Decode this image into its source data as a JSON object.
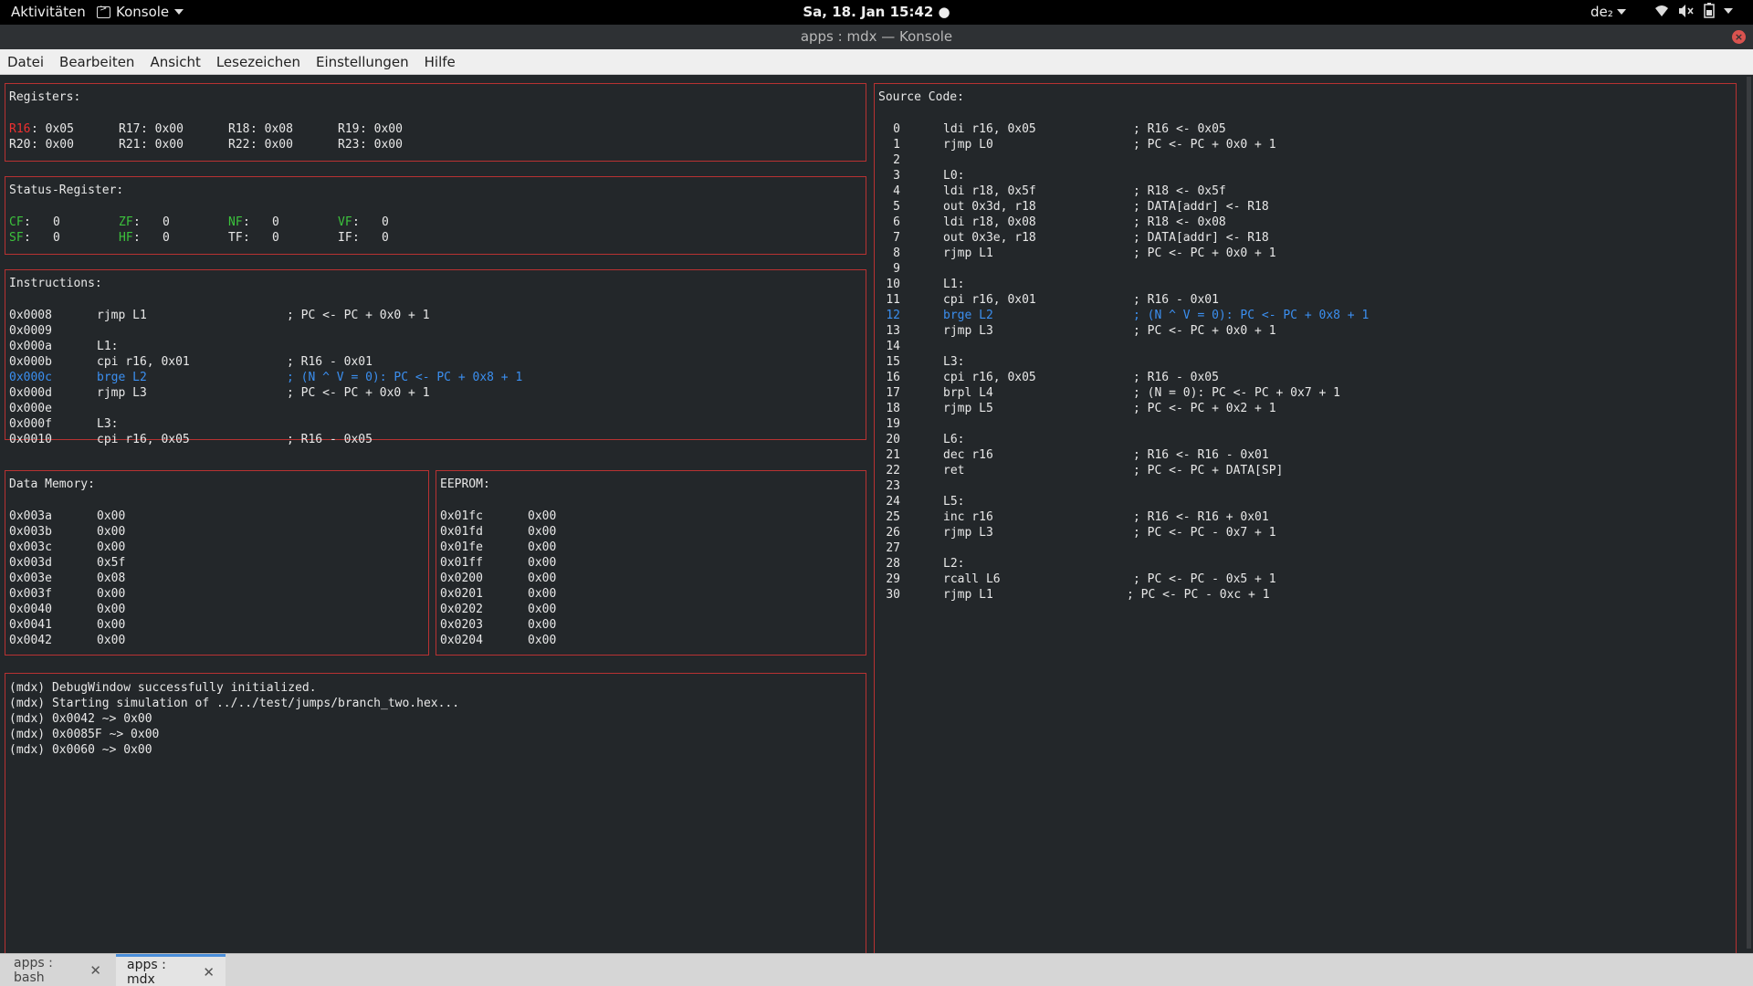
{
  "topbar": {
    "activities": "Aktivitäten",
    "app_menu": "Konsole",
    "clock": "Sa, 18. Jan  15:42 ●",
    "keyboard_layout": "de₂"
  },
  "window": {
    "title": "apps : mdx — Konsole"
  },
  "menubar": [
    "Datei",
    "Bearbeiten",
    "Ansicht",
    "Lesezeichen",
    "Einstellungen",
    "Hilfe"
  ],
  "registers": {
    "header": "Registers:",
    "rows": [
      [
        {
          "name": "R16",
          "value": ": 0x05",
          "highlight": true
        },
        {
          "name": "R17",
          "value": ": 0x00"
        },
        {
          "name": "R18",
          "value": ": 0x08"
        },
        {
          "name": "R19",
          "value": ": 0x00"
        }
      ],
      [
        {
          "name": "R20",
          "value": ": 0x00"
        },
        {
          "name": "R21",
          "value": ": 0x00"
        },
        {
          "name": "R22",
          "value": ": 0x00"
        },
        {
          "name": "R23",
          "value": ": 0x00"
        }
      ]
    ]
  },
  "status_register": {
    "header": "Status-Register:",
    "rows": [
      [
        {
          "name": "CF",
          "sep": ":",
          "value": "0",
          "green": true
        },
        {
          "name": "ZF",
          "sep": ":",
          "value": "0",
          "green": true
        },
        {
          "name": "NF",
          "sep": ":",
          "value": "0",
          "green": true
        },
        {
          "name": "VF",
          "sep": ":",
          "value": "0",
          "green": true
        }
      ],
      [
        {
          "name": "SF",
          "sep": ":",
          "value": "0",
          "green": true
        },
        {
          "name": "HF",
          "sep": ":",
          "value": "0",
          "green": true
        },
        {
          "name": "TF",
          "sep": ":",
          "value": "0",
          "green": false
        },
        {
          "name": "IF",
          "sep": ":",
          "value": "0",
          "green": false
        }
      ]
    ]
  },
  "instructions": {
    "header": "Instructions:",
    "rows": [
      {
        "addr": "0x0008",
        "code": "rjmp L1",
        "comment": "; PC <- PC + 0x0 + 1"
      },
      {
        "addr": "0x0009",
        "code": "",
        "comment": ""
      },
      {
        "addr": "0x000a",
        "code": "L1:",
        "comment": ""
      },
      {
        "addr": "0x000b",
        "code": "cpi r16, 0x01",
        "comment": "; R16 - 0x01"
      },
      {
        "addr": "0x000c",
        "code": "brge L2",
        "comment": "; (N ^ V = 0): PC <- PC + 0x8 + 1",
        "current": true
      },
      {
        "addr": "0x000d",
        "code": "rjmp L3",
        "comment": "; PC <- PC + 0x0 + 1"
      },
      {
        "addr": "0x000e",
        "code": "",
        "comment": ""
      },
      {
        "addr": "0x000f",
        "code": "L3:",
        "comment": ""
      },
      {
        "addr": "0x0010",
        "code": "cpi r16, 0x05",
        "comment": "; R16 - 0x05"
      }
    ]
  },
  "data_memory": {
    "header": "Data Memory:",
    "rows": [
      {
        "addr": "0x003a",
        "value": "0x00"
      },
      {
        "addr": "0x003b",
        "value": "0x00"
      },
      {
        "addr": "0x003c",
        "value": "0x00"
      },
      {
        "addr": "0x003d",
        "value": "0x5f"
      },
      {
        "addr": "0x003e",
        "value": "0x08"
      },
      {
        "addr": "0x003f",
        "value": "0x00"
      },
      {
        "addr": "0x0040",
        "value": "0x00"
      },
      {
        "addr": "0x0041",
        "value": "0x00"
      },
      {
        "addr": "0x0042",
        "value": "0x00"
      }
    ]
  },
  "eeprom": {
    "header": "EEPROM:",
    "rows": [
      {
        "addr": "0x01fc",
        "value": "0x00"
      },
      {
        "addr": "0x01fd",
        "value": "0x00"
      },
      {
        "addr": "0x01fe",
        "value": "0x00"
      },
      {
        "addr": "0x01ff",
        "value": "0x00"
      },
      {
        "addr": "0x0200",
        "value": "0x00"
      },
      {
        "addr": "0x0201",
        "value": "0x00"
      },
      {
        "addr": "0x0202",
        "value": "0x00"
      },
      {
        "addr": "0x0203",
        "value": "0x00"
      },
      {
        "addr": "0x0204",
        "value": "0x00"
      }
    ]
  },
  "log": {
    "lines": [
      "(mdx) DebugWindow successfully initialized.",
      "(mdx) Starting simulation of ../../test/jumps/branch_two.hex...",
      "(mdx) 0x0042 ~> 0x00",
      "(mdx) 0x0085F ~> 0x00",
      "(mdx) 0x0060 ~> 0x00"
    ]
  },
  "source_code": {
    "header": "Source Code:",
    "rows": [
      {
        "n": "0",
        "code": "ldi r16, 0x05",
        "comment": "; R16 <- 0x05"
      },
      {
        "n": "1",
        "code": "rjmp L0",
        "comment": "; PC <- PC + 0x0 + 1"
      },
      {
        "n": "2",
        "code": "",
        "comment": ""
      },
      {
        "n": "3",
        "code": "L0:",
        "comment": ""
      },
      {
        "n": "4",
        "code": "ldi r18, 0x5f",
        "comment": "; R18 <- 0x5f"
      },
      {
        "n": "5",
        "code": "out 0x3d, r18",
        "comment": "; DATA[addr] <- R18"
      },
      {
        "n": "6",
        "code": "ldi r18, 0x08",
        "comment": "; R18 <- 0x08"
      },
      {
        "n": "7",
        "code": "out 0x3e, r18",
        "comment": "; DATA[addr] <- R18"
      },
      {
        "n": "8",
        "code": "rjmp L1",
        "comment": "; PC <- PC + 0x0 + 1"
      },
      {
        "n": "9",
        "code": "",
        "comment": ""
      },
      {
        "n": "10",
        "code": "L1:",
        "comment": ""
      },
      {
        "n": "11",
        "code": "cpi r16, 0x01",
        "comment": "; R16 - 0x01"
      },
      {
        "n": "12",
        "code": "brge L2",
        "comment": "; (N ^ V = 0): PC <- PC + 0x8 + 1",
        "current": true
      },
      {
        "n": "13",
        "code": "rjmp L3",
        "comment": "; PC <- PC + 0x0 + 1"
      },
      {
        "n": "14",
        "code": "",
        "comment": ""
      },
      {
        "n": "15",
        "code": "L3:",
        "comment": ""
      },
      {
        "n": "16",
        "code": "cpi r16, 0x05",
        "comment": "; R16 - 0x05"
      },
      {
        "n": "17",
        "code": "brpl L4",
        "comment": "; (N = 0): PC <- PC + 0x7 + 1"
      },
      {
        "n": "18",
        "code": "rjmp L5",
        "comment": "; PC <- PC + 0x2 + 1"
      },
      {
        "n": "19",
        "code": "",
        "comment": ""
      },
      {
        "n": "20",
        "code": "L6:",
        "comment": ""
      },
      {
        "n": "21",
        "code": "dec r16",
        "comment": "; R16 <- R16 - 0x01"
      },
      {
        "n": "22",
        "code": "ret",
        "comment": "; PC <- PC + DATA[SP]"
      },
      {
        "n": "23",
        "code": "",
        "comment": ""
      },
      {
        "n": "24",
        "code": "L5:",
        "comment": ""
      },
      {
        "n": "25",
        "code": "inc r16",
        "comment": "; R16 <- R16 + 0x01"
      },
      {
        "n": "26",
        "code": "rjmp L3",
        "comment": "; PC <- PC - 0x7 + 1"
      },
      {
        "n": "27",
        "code": "",
        "comment": ""
      },
      {
        "n": "28",
        "code": "L2:",
        "comment": ""
      },
      {
        "n": "29",
        "code": "rcall L6",
        "comment": "; PC <- PC - 0x5 + 1"
      },
      {
        "n": "30",
        "code": "rjmp L1",
        "comment": "; PC <- PC - 0xc + 1",
        "shifted": true
      }
    ]
  },
  "command": {
    "prompt": ">>>",
    "value": ""
  },
  "tabs": [
    {
      "label": "apps : bash",
      "active": false
    },
    {
      "label": "apps : mdx",
      "active": true
    }
  ],
  "colors": {
    "border": "#b83232",
    "highlight_blue": "#3b8ff0",
    "flag_green": "#3cc33c",
    "register_red": "#ee3030",
    "terminal_bg": "#23272a"
  },
  "icons": {
    "app_menu": "terminal-icon",
    "wifi": "wifi-icon",
    "volume": "volume-muted-icon",
    "battery": "battery-icon",
    "close": "close-icon"
  }
}
